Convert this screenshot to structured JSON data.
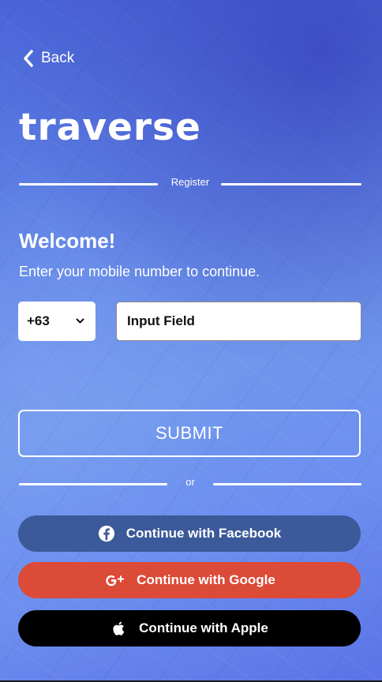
{
  "header": {
    "back_label": "Back"
  },
  "brand": {
    "logo_text": "traverse"
  },
  "register_divider": {
    "label": "Register"
  },
  "welcome": {
    "title": "Welcome!",
    "subtitle": "Enter your mobile number to continue."
  },
  "phone_form": {
    "country_code": "+63",
    "input_placeholder": "Input Field",
    "submit_label": "SUBMIT"
  },
  "or_divider": {
    "label": "or"
  },
  "social_buttons": [
    {
      "label": "Continue with Facebook",
      "icon": "facebook-icon",
      "color": "#3c5a99"
    },
    {
      "label": "Continue with Google",
      "icon": "google-plus-icon",
      "color": "#dc4a38"
    },
    {
      "label": "Continue with Apple",
      "icon": "apple-icon",
      "color": "#000000"
    }
  ],
  "colors": {
    "background_top": "#4a64d8",
    "background_mid": "#6f97ec",
    "text": "#ffffff"
  }
}
